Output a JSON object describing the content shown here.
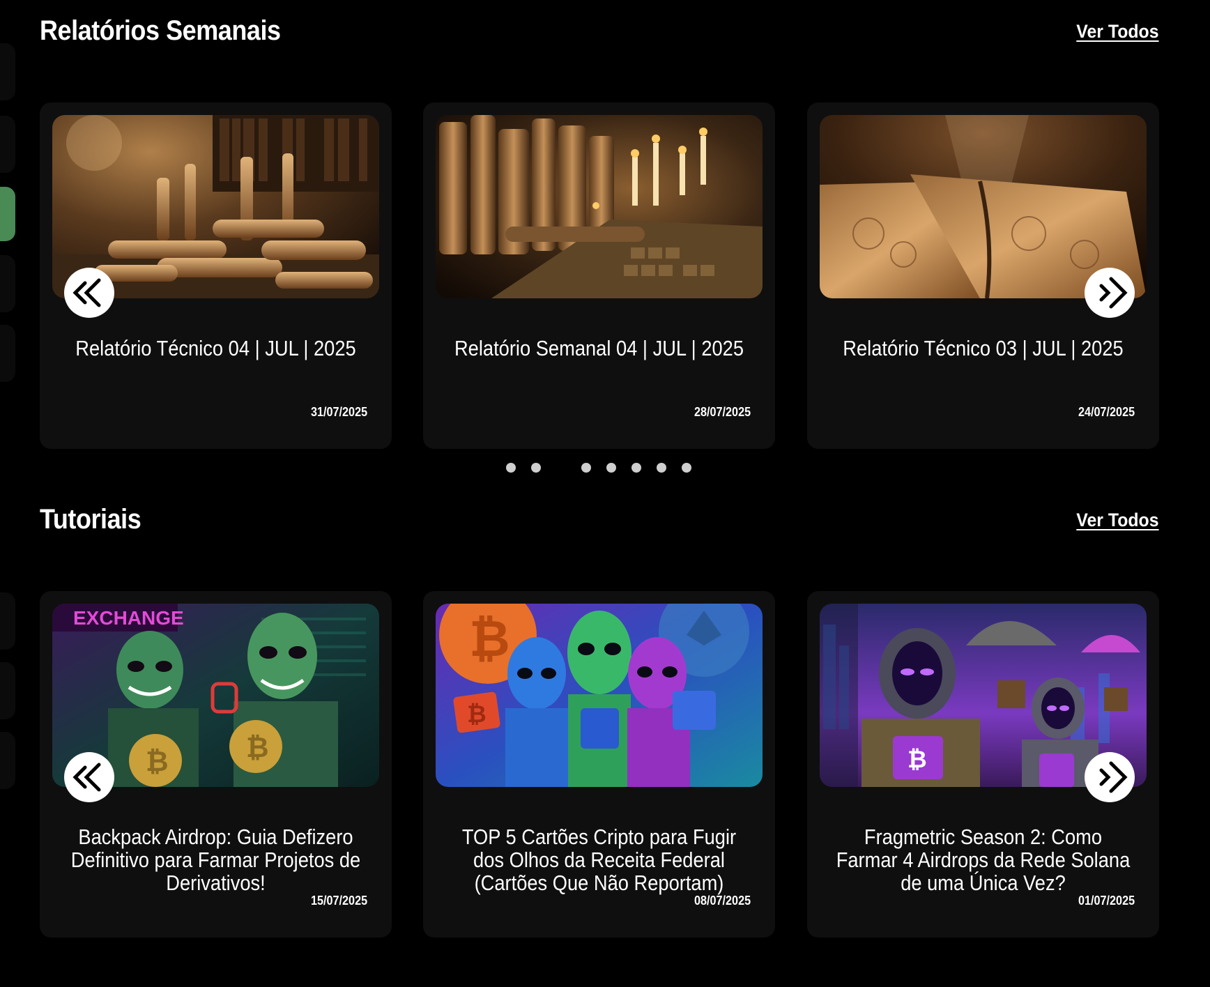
{
  "sections": [
    {
      "title": "Relatórios Semanais",
      "view_all": "Ver Todos",
      "cards": [
        {
          "title": "Relatório Técnico 04 | JUL | 2025",
          "date": "31/07/2025",
          "image": "scrolls-library-image"
        },
        {
          "title": "Relatório Semanal 04 | JUL | 2025",
          "date": "28/07/2025",
          "image": "ancient-books-candles-image"
        },
        {
          "title": "Relatório Técnico 03 | JUL | 2025",
          "date": "24/07/2025",
          "image": "open-ancient-book-image"
        }
      ],
      "pagination_dots": 7
    },
    {
      "title": "Tutoriais",
      "view_all": "Ver Todos",
      "cards": [
        {
          "title": "Backpack Airdrop: Guia Defizero Definitivo para Farmar Projetos de Derivativos!",
          "date": "15/07/2025",
          "image": "aliens-exchange-bitcoin-image"
        },
        {
          "title": "TOP 5 Cartões Cripto para Fugir dos Olhos da Receita Federal (Cartões Que Não Reportam)",
          "date": "08/07/2025",
          "image": "aliens-crypto-cards-image"
        },
        {
          "title": "Fragmetric Season 2: Como Farmar 4 Airdrops da Rede Solana de uma Única Vez?",
          "date": "01/07/2025",
          "image": "astronaut-aliens-airdrop-image"
        }
      ]
    }
  ],
  "colors": {
    "background": "#000000",
    "card": "#0f0f0f",
    "accent": "#4a8a55"
  },
  "icons": {
    "prev": "double-chevron-left-icon",
    "next": "double-chevron-right-icon"
  }
}
